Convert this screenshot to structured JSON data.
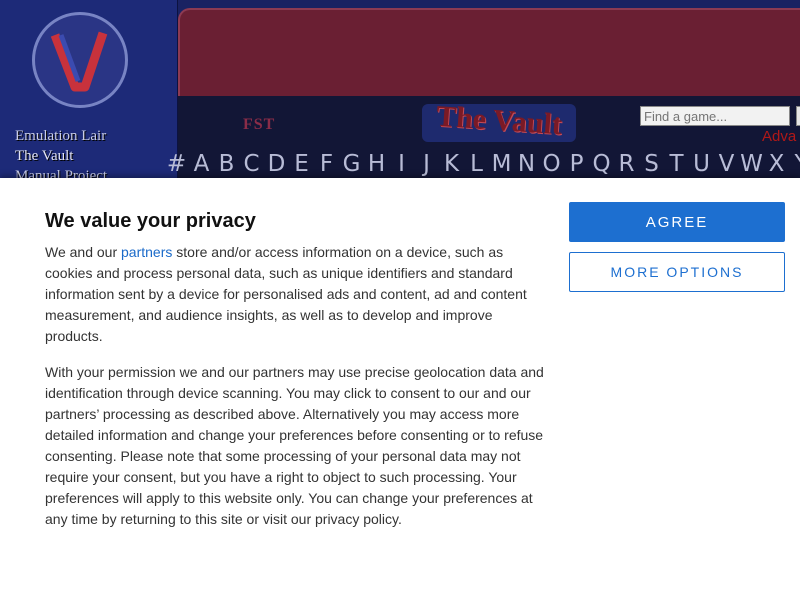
{
  "site": {
    "side_links": {
      "emulation_lair": "Emulation Lair",
      "the_vault": "The Vault",
      "manual_project": "Manual Project"
    },
    "fst_logo_text": "FST",
    "vault_title": "The Vault",
    "search": {
      "placeholder": "Find a game..."
    },
    "advanced_link": "Adva",
    "alphabet": [
      "#",
      "A",
      "B",
      "C",
      "D",
      "E",
      "F",
      "G",
      "H",
      "I",
      "J",
      "K",
      "L",
      "M",
      "N",
      "O",
      "P",
      "Q",
      "R",
      "S",
      "T",
      "U",
      "V",
      "W",
      "X",
      "Y"
    ],
    "colors": {
      "header_blue": "#1a2262",
      "banner_red": "#6a1f33",
      "accent_red": "#b01818"
    }
  },
  "consent": {
    "title": "We value your privacy",
    "para1_prefix": "We and our ",
    "para1_link": "partners",
    "para1_suffix": " store and/or access information on a device, such as cookies and process personal data, such as unique identifiers and standard information sent by a device for personalised ads and content, ad and content measurement, and audience insights, as well as to develop and improve products.",
    "para2": "With your permission we and our partners may use precise geolocation data and identification through device scanning. You may click to consent to our and our partners’ processing as described above. Alternatively you may access more detailed information and change your preferences before consenting or to refuse consenting. Please note that some processing of your personal data may not require your consent, but you have a right to object to such processing. Your preferences will apply to this website only. You can change your preferences at any time by returning to this site or visit our privacy policy.",
    "agree_label": "AGREE",
    "more_options_label": "MORE OPTIONS",
    "colors": {
      "primary": "#1d6fd0",
      "link": "#1a6ac9"
    }
  }
}
